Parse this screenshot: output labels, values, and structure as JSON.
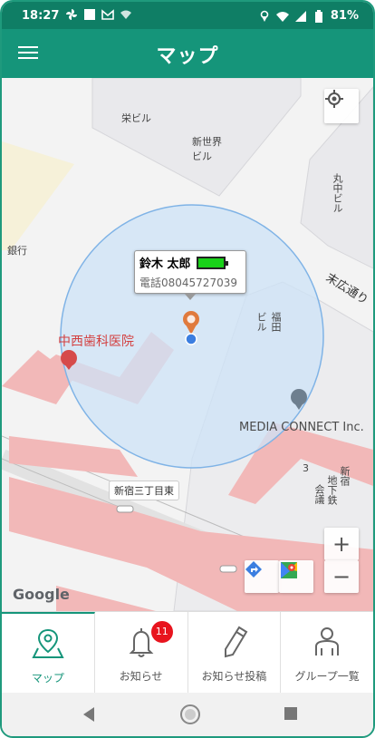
{
  "status_bar": {
    "time": "18:27",
    "battery_percent": "81%",
    "icons": [
      "pinwheel-icon",
      "square-icon",
      "gmail-icon",
      "wifi-question-icon",
      "location-icon",
      "wifi-icon",
      "signal-icon",
      "battery-icon"
    ]
  },
  "app_bar": {
    "title": "マップ",
    "menu_icon": "hamburger-menu-icon"
  },
  "map": {
    "labels": {
      "sakae_bldg": "栄ビル",
      "shinsekai_bldg": "新世界\nビル",
      "marunaka_bldg": "丸中ビル",
      "ginko": "銀行",
      "suehiro_dori": "末広通り",
      "fukuda_bldg": "福田\nビル",
      "nakanishi_dental": "中西歯科医院",
      "media_connect": "MEDIA CONNECT Inc.",
      "shinjuku_sanchome_higashi": "新宿三丁目東",
      "shinjuku_chikatetsu_1": "新宿",
      "shinjuku_chikatetsu_2": "地下鉄",
      "shinjuku_chikatetsu_3": "会議",
      "block_number": "3"
    },
    "callout": {
      "name": "鈴木 太郎",
      "phone": "電話08045727039",
      "battery_level": 1.0
    },
    "controls": {
      "zoom_in": "+",
      "zoom_out": "−",
      "my_location_icon": "target-icon",
      "directions_icon": "directions-icon",
      "maps_icon": "google-maps-icon"
    },
    "attribution": "Google",
    "colors": {
      "geofence_fill": "#cde3f7",
      "geofence_stroke": "#7fb3e6",
      "rail": "#f2b8b8",
      "user_dot": "#3b7ee0",
      "marker": "#e07a3d"
    }
  },
  "bottom_nav": {
    "items": [
      {
        "label": "マップ",
        "icon": "map-pin-icon",
        "active": true
      },
      {
        "label": "お知らせ",
        "icon": "bell-icon",
        "badge": "11"
      },
      {
        "label": "お知らせ投稿",
        "icon": "pencil-icon"
      },
      {
        "label": "グループ一覧",
        "icon": "user-icon"
      }
    ]
  },
  "system_nav": {
    "back_icon": "back-triangle-icon",
    "home_icon": "home-circle-icon",
    "recents_icon": "recents-square-icon"
  },
  "theme": {
    "primary": "#15957a",
    "primary_dark": "#0f7e65",
    "badge": "#e8141e"
  }
}
